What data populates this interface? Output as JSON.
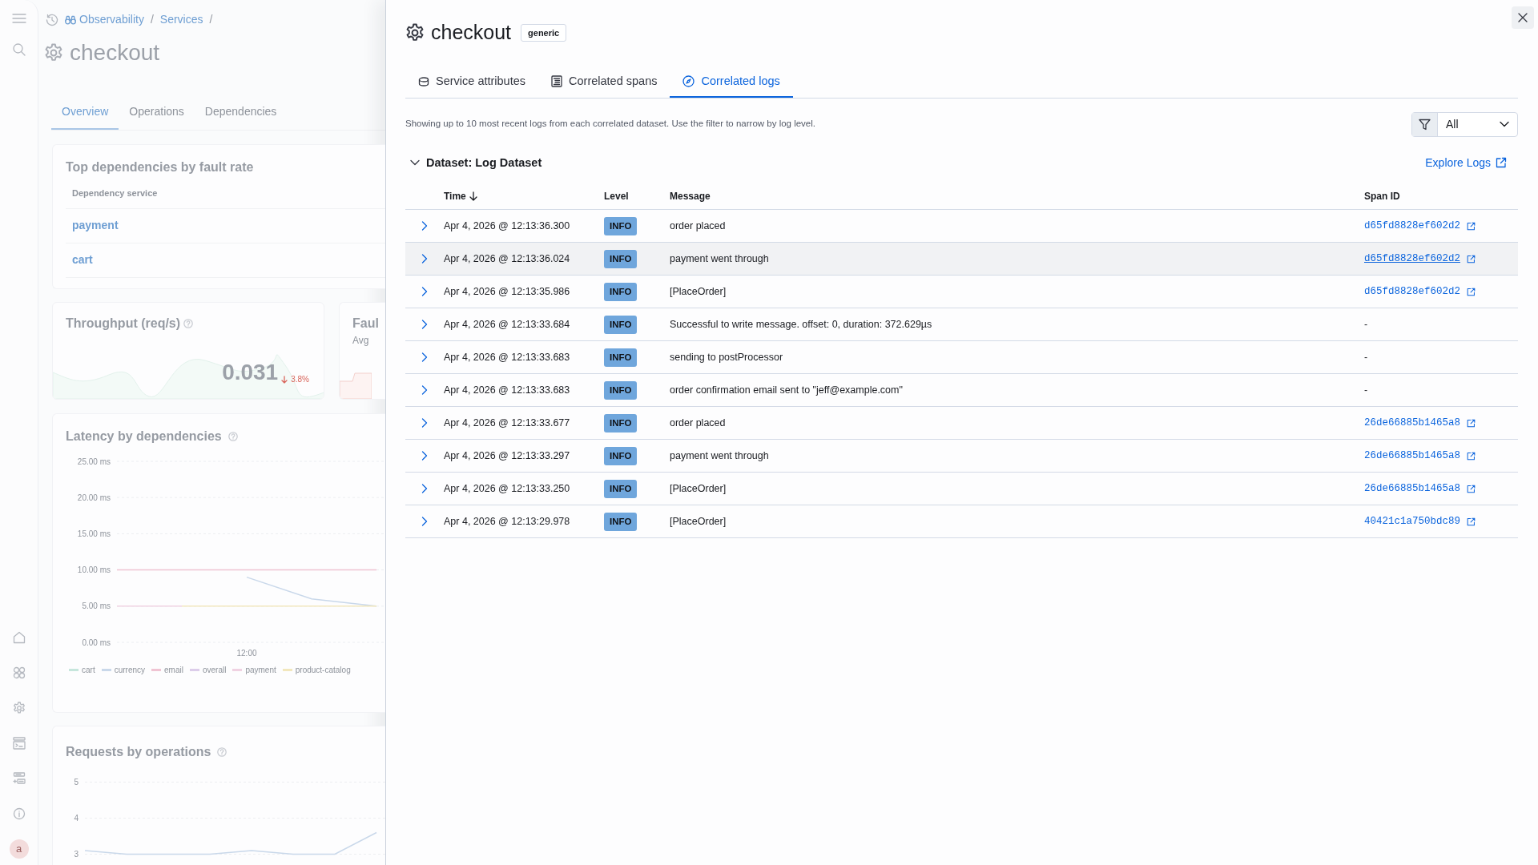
{
  "rail": {
    "avatar": "a"
  },
  "page": {
    "breadcrumbs": [
      {
        "label": "Observability"
      },
      {
        "label": "Services"
      }
    ],
    "separator": "/",
    "title": "checkout",
    "tabs": [
      {
        "label": "Overview",
        "selected": true
      },
      {
        "label": "Operations",
        "selected": false
      },
      {
        "label": "Dependencies",
        "selected": false
      }
    ],
    "dependencies_card": {
      "title": "Top dependencies by fault rate",
      "column": "Dependency service",
      "rows": [
        "payment",
        "cart"
      ]
    },
    "throughput_card": {
      "title": "Throughput (req/s)",
      "value": "0.031",
      "change": "3.8%",
      "negative": true
    },
    "fault_card": {
      "title": "Faul",
      "subtitle": "Avg"
    },
    "latency_card": {
      "title": "Latency by dependencies",
      "chart_data": {
        "type": "line",
        "grid": true,
        "categories": [
          null,
          null,
          null,
          null,
          null
        ],
        "ylim": [
          0,
          25
        ],
        "yticks": [
          {
            "value": 0,
            "label": "0.00 ms"
          },
          {
            "value": 5,
            "label": "5.00 ms"
          },
          {
            "value": 10,
            "label": "10.00 ms"
          },
          {
            "value": 15,
            "label": "15.00 ms"
          },
          {
            "value": 20,
            "label": "20.00 ms"
          },
          {
            "value": 25,
            "label": "25.00 ms"
          }
        ],
        "annotations": [
          "12:00"
        ],
        "series": [
          {
            "name": "cart",
            "color": "#c6e6dc",
            "values": [
              null,
              null,
              null,
              null,
              null
            ]
          },
          {
            "name": "currency",
            "color": "#c9d8ea",
            "values": [
              null,
              null,
              9,
              6,
              5
            ]
          },
          {
            "name": "email",
            "color": "#f0c4d3",
            "values": [
              10,
              10,
              10,
              10,
              10
            ]
          },
          {
            "name": "overall",
            "color": "#dccdea",
            "values": [
              null,
              null,
              null,
              null,
              null
            ]
          },
          {
            "name": "payment",
            "color": "#f0d2e2",
            "values": [
              5,
              5,
              null,
              null,
              null
            ]
          },
          {
            "name": "product-catalog",
            "color": "#f2e7bd",
            "values": [
              null,
              5,
              5,
              5,
              5
            ]
          }
        ]
      }
    },
    "requests_card": {
      "title": "Requests by operations",
      "chart_data": {
        "type": "line",
        "grid": true,
        "categories": [
          null,
          null,
          null,
          null,
          null,
          null,
          null,
          null
        ],
        "ylim": [
          3,
          5
        ],
        "yticks": [
          3,
          4,
          5
        ],
        "series": [
          {
            "color": "#c9d8ea",
            "values": [
              3.1,
              3.0,
              3.0,
              3.0,
              3.1,
              3.0,
              3.0,
              3.6
            ]
          }
        ]
      }
    }
  },
  "flyout": {
    "title": "checkout",
    "badge": "generic",
    "tabs": [
      {
        "label": "Service attributes",
        "selected": false
      },
      {
        "label": "Correlated spans",
        "selected": false
      },
      {
        "label": "Correlated logs",
        "selected": true
      }
    ],
    "description": "Showing up to 10 most recent logs from each correlated dataset. Use the filter to narrow by log level.",
    "filter": {
      "value": "All"
    },
    "datasets": [
      {
        "title": "Dataset: Log Dataset",
        "expanded": true,
        "explore_link": "Explore Logs",
        "columns": [
          {
            "label": "Time",
            "sorted": true
          },
          {
            "label": "Level",
            "sorted": false
          },
          {
            "label": "Message",
            "sorted": false
          },
          {
            "label": "Span ID",
            "sorted": false
          }
        ],
        "rows": [
          {
            "time": "Apr 4, 2026 @ 12:13:36.300",
            "level": "INFO",
            "message": "order placed",
            "span_id": "d65fd8828ef602d2",
            "span_link": true,
            "hovered": false
          },
          {
            "time": "Apr 4, 2026 @ 12:13:36.024",
            "level": "INFO",
            "message": "payment went through",
            "span_id": "d65fd8828ef602d2",
            "span_link": true,
            "hovered": true
          },
          {
            "time": "Apr 4, 2026 @ 12:13:35.986",
            "level": "INFO",
            "message": "[PlaceOrder]",
            "span_id": "d65fd8828ef602d2",
            "span_link": true,
            "hovered": false
          },
          {
            "time": "Apr 4, 2026 @ 12:13:33.684",
            "level": "INFO",
            "message": "Successful to write message. offset: 0, duration: 372.629µs",
            "span_id": "-",
            "span_link": false,
            "hovered": false
          },
          {
            "time": "Apr 4, 2026 @ 12:13:33.683",
            "level": "INFO",
            "message": "sending to postProcessor",
            "span_id": "-",
            "span_link": false,
            "hovered": false
          },
          {
            "time": "Apr 4, 2026 @ 12:13:33.683",
            "level": "INFO",
            "message": "order confirmation email sent to \"jeff@example.com\"",
            "span_id": "-",
            "span_link": false,
            "hovered": false
          },
          {
            "time": "Apr 4, 2026 @ 12:13:33.677",
            "level": "INFO",
            "message": "order placed",
            "span_id": "26de66885b1465a8",
            "span_link": true,
            "hovered": false
          },
          {
            "time": "Apr 4, 2026 @ 12:13:33.297",
            "level": "INFO",
            "message": "payment went through",
            "span_id": "26de66885b1465a8",
            "span_link": true,
            "hovered": false
          },
          {
            "time": "Apr 4, 2026 @ 12:13:33.250",
            "level": "INFO",
            "message": "[PlaceOrder]",
            "span_id": "26de66885b1465a8",
            "span_link": true,
            "hovered": false
          },
          {
            "time": "Apr 4, 2026 @ 12:13:29.978",
            "level": "INFO",
            "message": "[PlaceOrder]",
            "span_id": "40421c1a750bdc89",
            "span_link": true,
            "hovered": false
          }
        ]
      }
    ]
  }
}
